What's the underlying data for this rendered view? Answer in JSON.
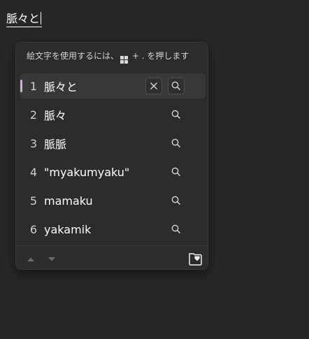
{
  "composition": {
    "text": "脈々と"
  },
  "candidate_window": {
    "hint_prefix": "絵文字を使用するには、",
    "hint_suffix": " + . を押します",
    "candidates": [
      {
        "number": "1",
        "text": "脈々と",
        "selected": true
      },
      {
        "number": "2",
        "text": "脈々",
        "selected": false
      },
      {
        "number": "3",
        "text": "脈脈",
        "selected": false
      },
      {
        "number": "4",
        "text": "\"myakumyaku\"",
        "selected": false
      },
      {
        "number": "5",
        "text": "mamaku",
        "selected": false
      },
      {
        "number": "6",
        "text": "yakamik",
        "selected": false
      }
    ],
    "icons": {
      "delete": "close-icon",
      "search": "search-icon",
      "page_up": "triangle-up-icon",
      "page_down": "triangle-down-icon",
      "favorite": "heart-folder-icon",
      "windows_key": "windows-logo-icon"
    }
  },
  "colors": {
    "background": "#272727",
    "panel": "#2c2c2c",
    "selected_row": "#383838",
    "accent": "#e2a5f0"
  }
}
